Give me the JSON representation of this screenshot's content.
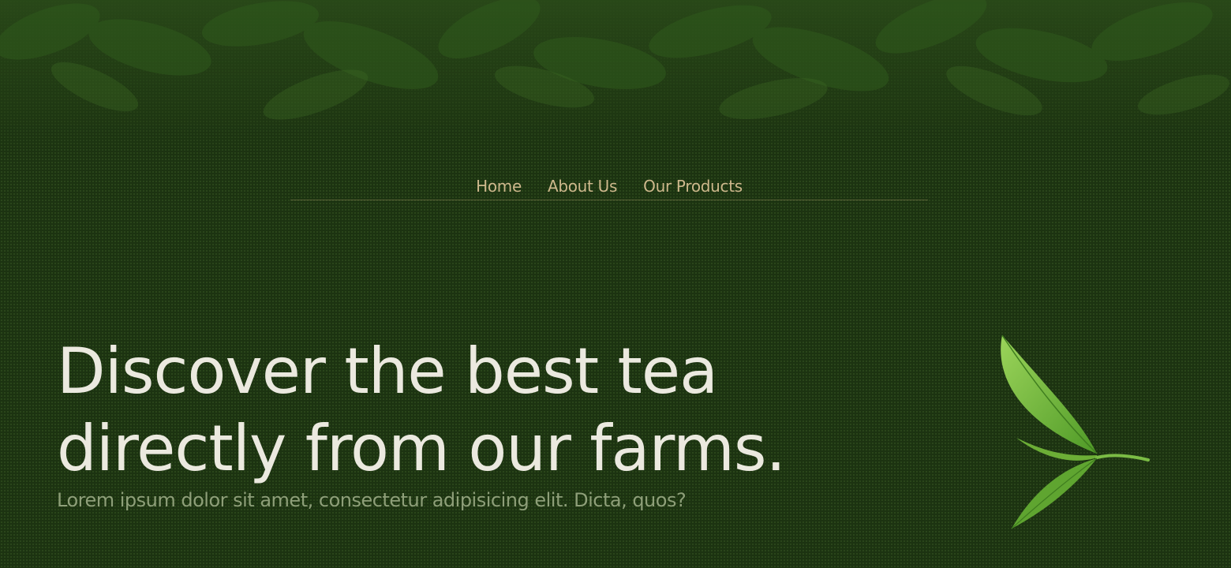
{
  "nav": {
    "items": [
      {
        "label": "Home"
      },
      {
        "label": "About Us"
      },
      {
        "label": "Our Products"
      }
    ]
  },
  "hero": {
    "title_line1": "Discover the best tea",
    "title_line2": "directly from our farms.",
    "subtitle": "Lorem ipsum dolor sit amet, consectetur adipisicing elit. Dicta, quos?"
  },
  "colors": {
    "background": "#1c3311",
    "nav_text": "#cdb88c",
    "title_text": "#ebe9df",
    "subtitle_text": "#8e9f79",
    "leaf": "#6fb23a"
  },
  "icons": {
    "leaf": "tea-leaf-icon"
  }
}
